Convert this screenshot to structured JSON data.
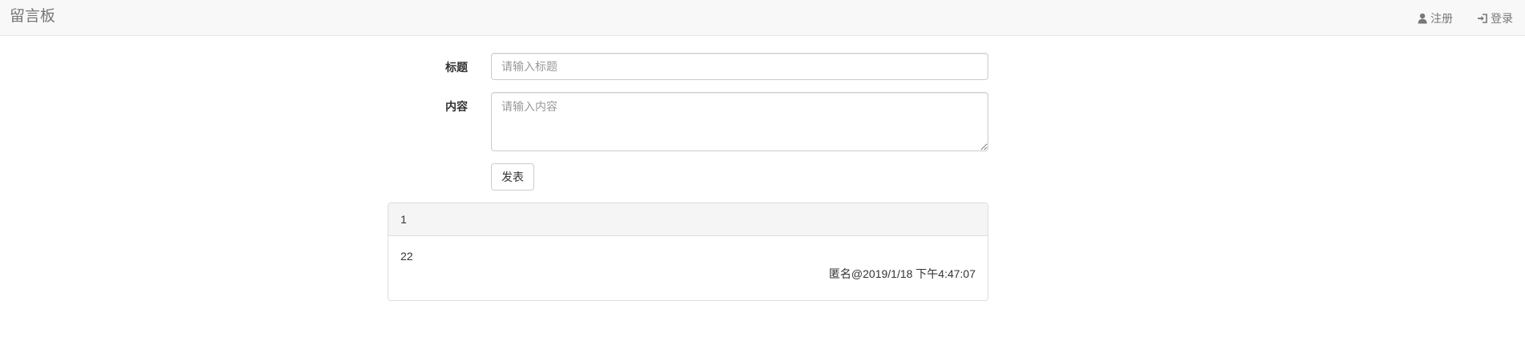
{
  "navbar": {
    "brand": "留言板",
    "register_label": "注册",
    "login_label": "登录",
    "register_icon": "user-icon",
    "login_icon": "login-icon"
  },
  "form": {
    "title_label": "标题",
    "title_placeholder": "请输入标题",
    "title_value": "",
    "content_label": "内容",
    "content_placeholder": "请输入内容",
    "content_value": "",
    "submit_label": "发表"
  },
  "messages": [
    {
      "title": "1",
      "content": "22",
      "meta": "匿名@2019/1/18 下午4:47:07"
    }
  ]
}
